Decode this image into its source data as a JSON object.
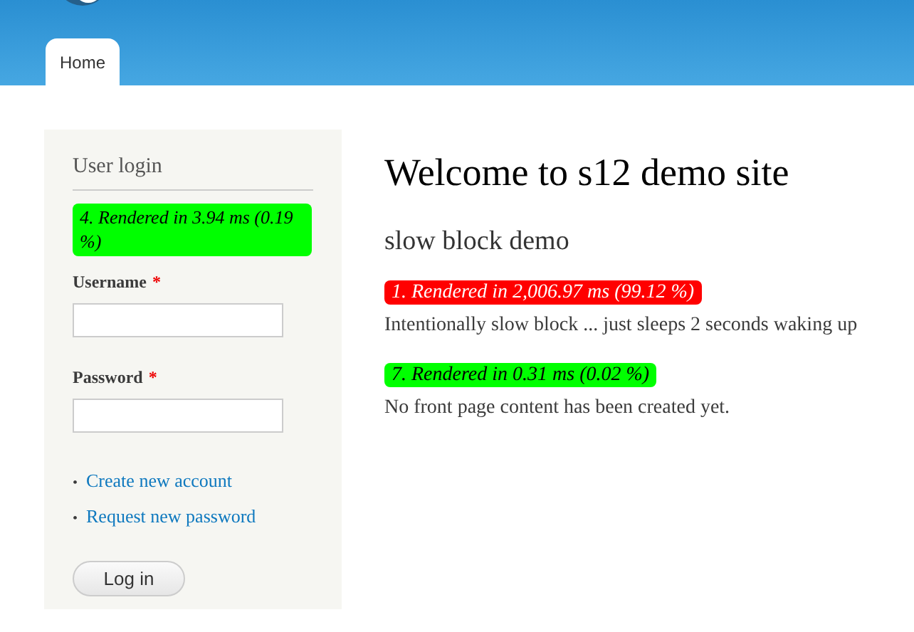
{
  "header": {
    "tabs": [
      {
        "label": "Home",
        "selected": true
      }
    ]
  },
  "sidebar": {
    "title": "User login",
    "render_note": {
      "text": "4. Rendered in 3.94 ms (0.19 %)",
      "color": "#00ff00"
    },
    "fields": [
      {
        "label": "Username",
        "required_mark": "*"
      },
      {
        "label": "Password",
        "required_mark": "*"
      }
    ],
    "links": [
      {
        "bullet": "•",
        "text": "Create new account"
      },
      {
        "bullet": "•",
        "text": "Request new password"
      }
    ],
    "button": "Log in"
  },
  "main": {
    "title": "Welcome to s12 demo site",
    "block_title": "slow block demo",
    "blocks": [
      {
        "render_note": {
          "text": "1. Rendered in 2,006.97 ms (99.12 %)",
          "color": "#ff0000"
        },
        "text": "Intentionally slow block ... just sleeps 2 seconds waking up"
      },
      {
        "render_note": {
          "text": "7. Rendered in 0.31 ms (0.02 %)",
          "color": "#00ff00"
        },
        "text": "No front page content has been created yet."
      }
    ]
  }
}
